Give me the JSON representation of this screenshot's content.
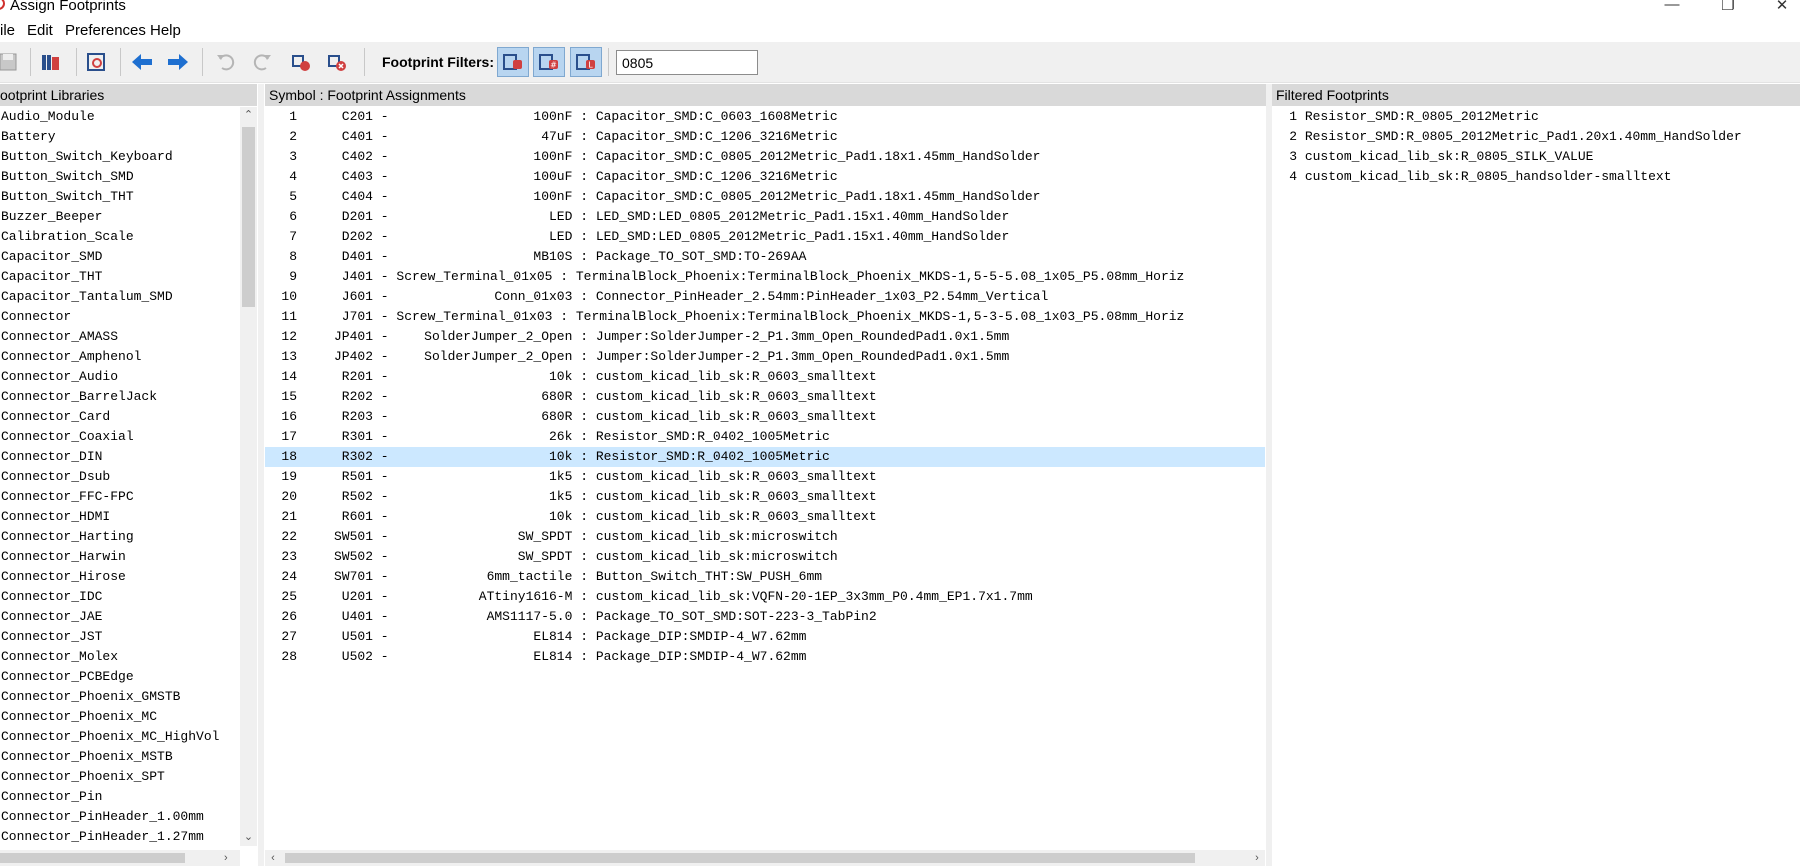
{
  "window": {
    "title": "Assign Footprints",
    "controls": [
      "minimize",
      "maximize",
      "close"
    ]
  },
  "menu": [
    "ile",
    "Edit",
    "Preferences",
    "Help"
  ],
  "toolbar": {
    "filters_label": "Footprint Filters:",
    "filter_value": "0805",
    "accent": "#b8d5f0"
  },
  "panels": {
    "libraries_title": "ootprint Libraries",
    "assignments_title": "Symbol : Footprint Assignments",
    "filtered_title": "Filtered Footprints"
  },
  "libraries": [
    "Audio_Module",
    "Battery",
    "Button_Switch_Keyboard",
    "Button_Switch_SMD",
    "Button_Switch_THT",
    "Buzzer_Beeper",
    "Calibration_Scale",
    "Capacitor_SMD",
    "Capacitor_THT",
    "Capacitor_Tantalum_SMD",
    "Connector",
    "Connector_AMASS",
    "Connector_Amphenol",
    "Connector_Audio",
    "Connector_BarrelJack",
    "Connector_Card",
    "Connector_Coaxial",
    "Connector_DIN",
    "Connector_Dsub",
    "Connector_FFC-FPC",
    "Connector_HDMI",
    "Connector_Harting",
    "Connector_Harwin",
    "Connector_Hirose",
    "Connector_IDC",
    "Connector_JAE",
    "Connector_JST",
    "Connector_Molex",
    "Connector_PCBEdge",
    "Connector_Phoenix_GMSTB",
    "Connector_Phoenix_MC",
    "Connector_Phoenix_MC_HighVol",
    "Connector_Phoenix_MSTB",
    "Connector_Phoenix_SPT",
    "Connector_Pin",
    "Connector_PinHeader_1.00mm",
    "Connector_PinHeader_1.27mm"
  ],
  "assignments": [
    {
      "n": "1",
      "ref": "C201",
      "value": "100nF",
      "fp": "Capacitor_SMD:C_0603_1608Metric"
    },
    {
      "n": "2",
      "ref": "C401",
      "value": "47uF",
      "fp": "Capacitor_SMD:C_1206_3216Metric"
    },
    {
      "n": "3",
      "ref": "C402",
      "value": "100nF",
      "fp": "Capacitor_SMD:C_0805_2012Metric_Pad1.18x1.45mm_HandSolder"
    },
    {
      "n": "4",
      "ref": "C403",
      "value": "100uF",
      "fp": "Capacitor_SMD:C_1206_3216Metric"
    },
    {
      "n": "5",
      "ref": "C404",
      "value": "100nF",
      "fp": "Capacitor_SMD:C_0805_2012Metric_Pad1.18x1.45mm_HandSolder"
    },
    {
      "n": "6",
      "ref": "D201",
      "value": "LED",
      "fp": "LED_SMD:LED_0805_2012Metric_Pad1.15x1.40mm_HandSolder"
    },
    {
      "n": "7",
      "ref": "D202",
      "value": "LED",
      "fp": "LED_SMD:LED_0805_2012Metric_Pad1.15x1.40mm_HandSolder"
    },
    {
      "n": "8",
      "ref": "D401",
      "value": "MB10S",
      "fp": "Package_TO_SOT_SMD:TO-269AA"
    },
    {
      "n": "9",
      "ref": "J401",
      "value": "Screw_Terminal_01x05",
      "fp": "TerminalBlock_Phoenix:TerminalBlock_Phoenix_MKDS-1,5-5-5.08_1x05_P5.08mm_Horiz"
    },
    {
      "n": "10",
      "ref": "J601",
      "value": "Conn_01x03",
      "fp": "Connector_PinHeader_2.54mm:PinHeader_1x03_P2.54mm_Vertical"
    },
    {
      "n": "11",
      "ref": "J701",
      "value": "Screw_Terminal_01x03",
      "fp": "TerminalBlock_Phoenix:TerminalBlock_Phoenix_MKDS-1,5-3-5.08_1x03_P5.08mm_Horiz"
    },
    {
      "n": "12",
      "ref": "JP401",
      "value": "SolderJumper_2_Open",
      "fp": "Jumper:SolderJumper-2_P1.3mm_Open_RoundedPad1.0x1.5mm"
    },
    {
      "n": "13",
      "ref": "JP402",
      "value": "SolderJumper_2_Open",
      "fp": "Jumper:SolderJumper-2_P1.3mm_Open_RoundedPad1.0x1.5mm"
    },
    {
      "n": "14",
      "ref": "R201",
      "value": "10k",
      "fp": "custom_kicad_lib_sk:R_0603_smalltext"
    },
    {
      "n": "15",
      "ref": "R202",
      "value": "680R",
      "fp": "custom_kicad_lib_sk:R_0603_smalltext"
    },
    {
      "n": "16",
      "ref": "R203",
      "value": "680R",
      "fp": "custom_kicad_lib_sk:R_0603_smalltext"
    },
    {
      "n": "17",
      "ref": "R301",
      "value": "26k",
      "fp": "Resistor_SMD:R_0402_1005Metric"
    },
    {
      "n": "18",
      "ref": "R302",
      "value": "10k",
      "fp": "Resistor_SMD:R_0402_1005Metric",
      "selected": true
    },
    {
      "n": "19",
      "ref": "R501",
      "value": "1k5",
      "fp": "custom_kicad_lib_sk:R_0603_smalltext"
    },
    {
      "n": "20",
      "ref": "R502",
      "value": "1k5",
      "fp": "custom_kicad_lib_sk:R_0603_smalltext"
    },
    {
      "n": "21",
      "ref": "R601",
      "value": "10k",
      "fp": "custom_kicad_lib_sk:R_0603_smalltext"
    },
    {
      "n": "22",
      "ref": "SW501",
      "value": "SW_SPDT",
      "fp": "custom_kicad_lib_sk:microswitch"
    },
    {
      "n": "23",
      "ref": "SW502",
      "value": "SW_SPDT",
      "fp": "custom_kicad_lib_sk:microswitch"
    },
    {
      "n": "24",
      "ref": "SW701",
      "value": "6mm_tactile",
      "fp": "Button_Switch_THT:SW_PUSH_6mm"
    },
    {
      "n": "25",
      "ref": "U201",
      "value": "ATtiny1616-M",
      "fp": "custom_kicad_lib_sk:VQFN-20-1EP_3x3mm_P0.4mm_EP1.7x1.7mm"
    },
    {
      "n": "26",
      "ref": "U401",
      "value": "AMS1117-5.0",
      "fp": "Package_TO_SOT_SMD:SOT-223-3_TabPin2"
    },
    {
      "n": "27",
      "ref": "U501",
      "value": "EL814",
      "fp": "Package_DIP:SMDIP-4_W7.62mm"
    },
    {
      "n": "28",
      "ref": "U502",
      "value": "EL814",
      "fp": "Package_DIP:SMDIP-4_W7.62mm"
    }
  ],
  "filtered": [
    {
      "n": "1",
      "fp": "Resistor_SMD:R_0805_2012Metric"
    },
    {
      "n": "2",
      "fp": "Resistor_SMD:R_0805_2012Metric_Pad1.20x1.40mm_HandSolder"
    },
    {
      "n": "3",
      "fp": "custom_kicad_lib_sk:R_0805_SILK_VALUE"
    },
    {
      "n": "4",
      "fp": "custom_kicad_lib_sk:R_0805_handsolder-smalltext"
    }
  ]
}
